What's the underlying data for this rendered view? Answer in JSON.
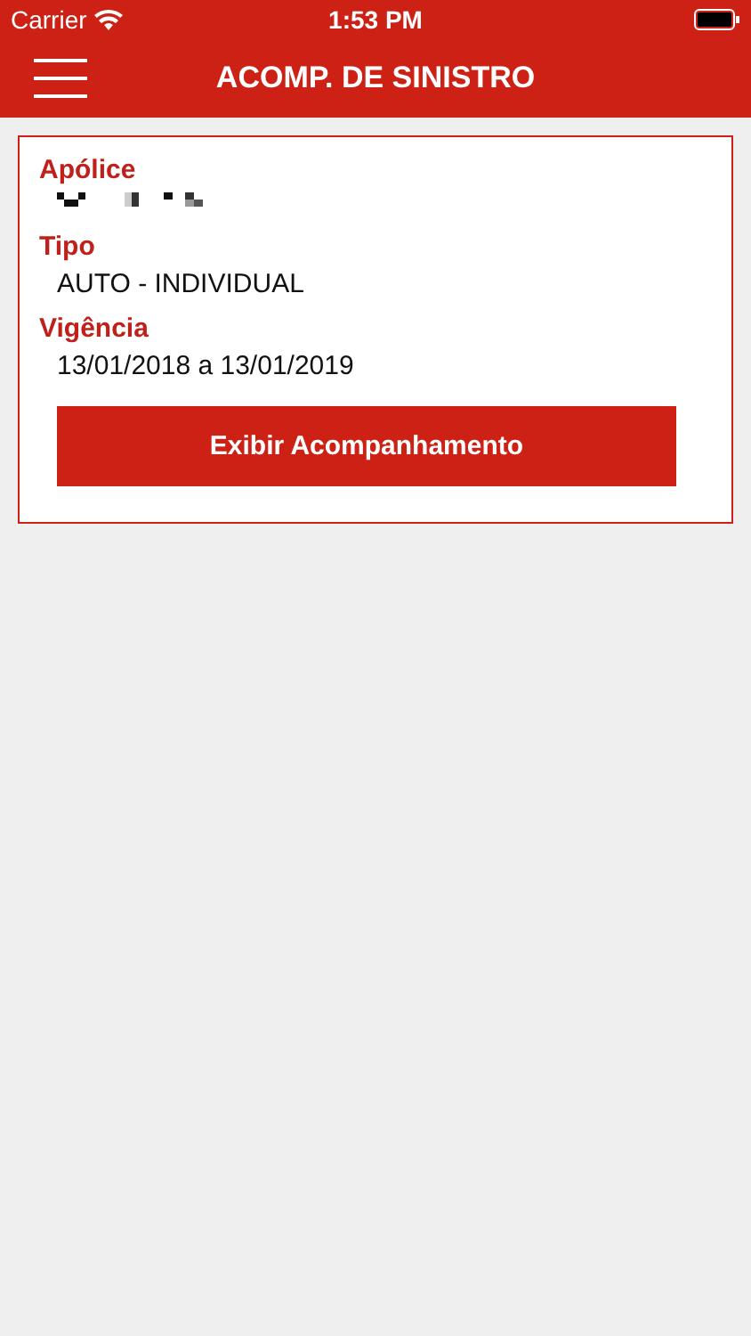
{
  "status_bar": {
    "carrier": "Carrier",
    "time": "1:53 PM"
  },
  "nav_bar": {
    "title": "ACOMP. DE SINISTRO"
  },
  "card": {
    "fields": [
      {
        "label": "Apólice",
        "kind": "redacted"
      },
      {
        "label": "Tipo",
        "kind": "text",
        "value": "AUTO - INDIVIDUAL"
      },
      {
        "label": "Vigência",
        "kind": "text",
        "value": "13/01/2018 a 13/01/2019"
      }
    ],
    "button": "Exibir Acompanhamento"
  }
}
